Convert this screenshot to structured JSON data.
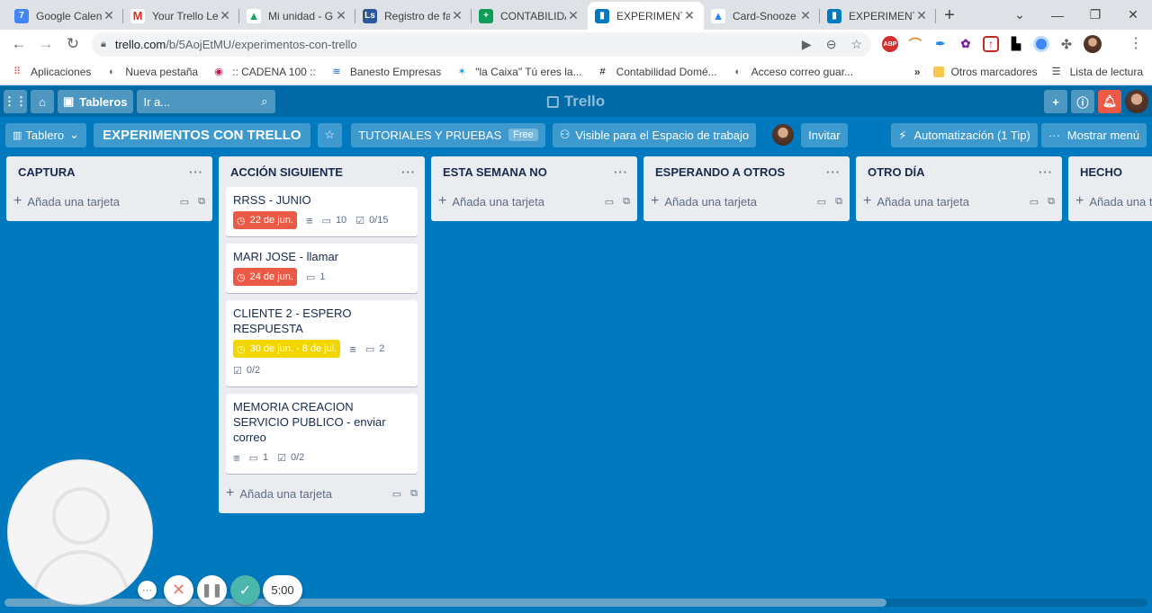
{
  "browser": {
    "tabs": [
      {
        "title": "Google Calen",
        "favicon": "calendar-icon",
        "color": "#4285f4",
        "glyph": "7",
        "active": false
      },
      {
        "title": "Your Trello Le",
        "favicon": "gmail-icon",
        "color": "#ffffff",
        "glyph": "M",
        "active": false
      },
      {
        "title": "Mi unidad - G",
        "favicon": "drive-icon",
        "color": "#ffffff",
        "glyph": "▲",
        "active": false
      },
      {
        "title": "Registro de fa",
        "favicon": "document-icon",
        "color": "#2b579a",
        "glyph": "Ls",
        "active": false
      },
      {
        "title": "CONTABILIDA",
        "favicon": "sheets-icon",
        "color": "#0f9d58",
        "glyph": "+",
        "active": false
      },
      {
        "title": "EXPERIMENTO",
        "favicon": "trello-icon",
        "color": "#0079bf",
        "glyph": "▮",
        "active": true
      },
      {
        "title": "Card-Snooze",
        "favicon": "atlassian-icon",
        "color": "#ffffff",
        "glyph": "▲",
        "active": false
      },
      {
        "title": "EXPERIMENTO",
        "favicon": "trello-icon",
        "color": "#0079bf",
        "glyph": "▮",
        "active": false
      }
    ],
    "url_host": "trello.com",
    "url_path": "/b/5AojEtMU/experimentos-con-trello",
    "bookmarks": [
      {
        "label": "Aplicaciones",
        "icon": "apps-grid-icon"
      },
      {
        "label": "Nueva pestaña",
        "icon": "globe-icon"
      },
      {
        "label": ":: CADENA 100 ::",
        "icon": "radio-icon"
      },
      {
        "label": "Banesto Empresas",
        "icon": "bank-icon"
      },
      {
        "label": "\"la Caixa\" Tú eres la...",
        "icon": "star-icon"
      },
      {
        "label": "Contabilidad Domé...",
        "icon": "hash-icon"
      },
      {
        "label": "Acceso correo guar...",
        "icon": "globe-icon"
      }
    ],
    "bookmarks_more": "»",
    "other_bookmarks": "Otros marcadores",
    "reading_list": "Lista de lectura"
  },
  "trello_header": {
    "boards_label": "Tableros",
    "search_placeholder": "Ir a...",
    "logo_text": "Trello"
  },
  "board_header": {
    "view_label": "Tablero",
    "board_title": "EXPERIMENTOS CON TRELLO",
    "workspace_label": "TUTORIALES Y PRUEBAS",
    "plan_badge": "Free",
    "visibility_label": "Visible para el Espacio de trabajo",
    "invite_label": "Invitar",
    "automation_label": "Automatización (1 Tip)",
    "menu_label": "Mostrar menú"
  },
  "lists": [
    {
      "title": "CAPTURA",
      "add_label": "Añada una tarjeta",
      "cards": []
    },
    {
      "title": "ACCIÓN SIGUIENTE",
      "add_label": "Añada una tarjeta",
      "cards": [
        {
          "title": "RRSS - JUNIO",
          "due": "22 de jun.",
          "due_color": "red",
          "description": true,
          "comments": "10",
          "checklist": "0/15"
        },
        {
          "title": "MARI JOSE - llamar",
          "due": "24 de jun.",
          "due_color": "red",
          "description": false,
          "comments": "1",
          "checklist": ""
        },
        {
          "title": "CLIENTE 2 - ESPERO RESPUESTA",
          "due": "30 de jun. - 8 de jul.",
          "due_color": "yellow",
          "description": true,
          "comments": "2",
          "checklist": "0/2"
        },
        {
          "title": "MEMORIA CREACION SERVICIO PUBLICO - enviar correo",
          "due": "",
          "due_color": "",
          "description": true,
          "comments": "1",
          "checklist": "0/2"
        }
      ]
    },
    {
      "title": "ESTA SEMANA NO",
      "add_label": "Añada una tarjeta",
      "cards": []
    },
    {
      "title": "ESPERANDO A OTROS",
      "add_label": "Añada una tarjeta",
      "cards": []
    },
    {
      "title": "OTRO DÍA",
      "add_label": "Añada una tarjeta",
      "cards": []
    },
    {
      "title": "HECHO",
      "add_label": "Añada una tarjeta",
      "cards": []
    }
  ],
  "recorder": {
    "timer": "5:00"
  }
}
